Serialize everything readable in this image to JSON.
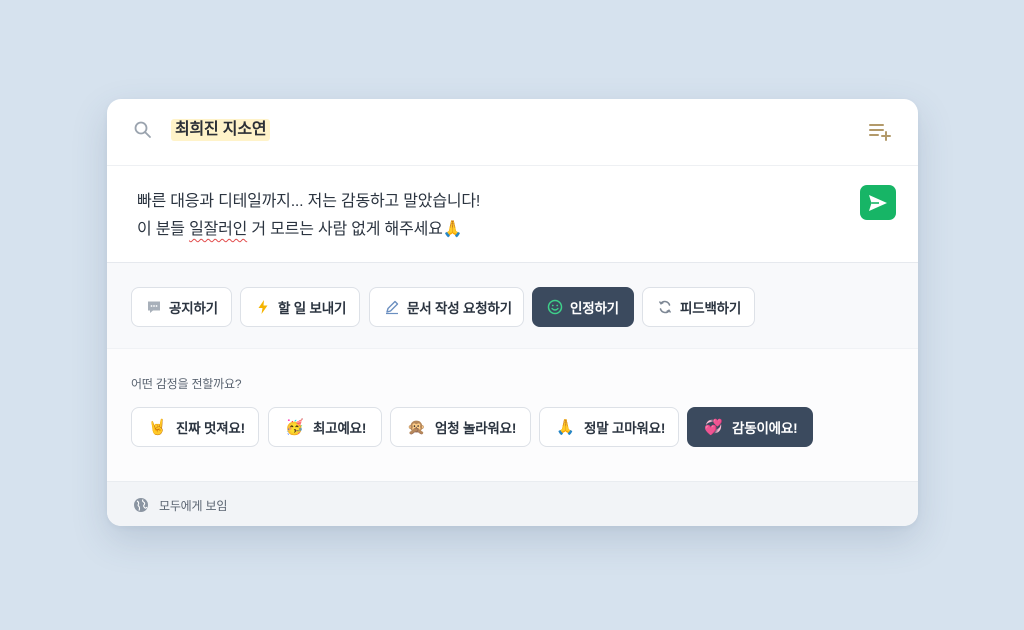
{
  "recipients": {
    "selected": "최희진 지소연"
  },
  "message": {
    "line1": "빠른 대응과 디테일까지... 저는 감동하고 말았습니다!",
    "line2_a": "이 분들 ",
    "line2_misspelled": "일잘러인",
    "line2_b": " 거 모르는 사람 없게 해주세요",
    "line2_emoji": "🙏"
  },
  "types": [
    {
      "label": "공지하기",
      "icon": "chat-bubble-icon"
    },
    {
      "label": "할 일 보내기",
      "icon": "lightning-icon"
    },
    {
      "label": "문서 작성 요청하기",
      "icon": "pen-icon"
    },
    {
      "label": "인정하기",
      "icon": "smile-icon",
      "active": true
    },
    {
      "label": "피드백하기",
      "icon": "sync-icon"
    }
  ],
  "emotion": {
    "question": "어떤 감정을 전할까요?",
    "options": [
      {
        "emoji": "🤘",
        "label": "진짜 멋져요!"
      },
      {
        "emoji": "🥳",
        "label": "최고예요!"
      },
      {
        "emoji": "🙊",
        "label": "엄청 놀라워요!"
      },
      {
        "emoji": "🙏",
        "label": "정말 고마워요!"
      },
      {
        "emoji": "💞",
        "label": "감동이에요!",
        "active": true
      }
    ]
  },
  "footer": {
    "visibility": "모두에게 보임"
  },
  "colors": {
    "background": "#d6e2ee",
    "active_dark": "#3b4a5e",
    "send_green": "#17b566",
    "highlight": "#fff3c9"
  }
}
